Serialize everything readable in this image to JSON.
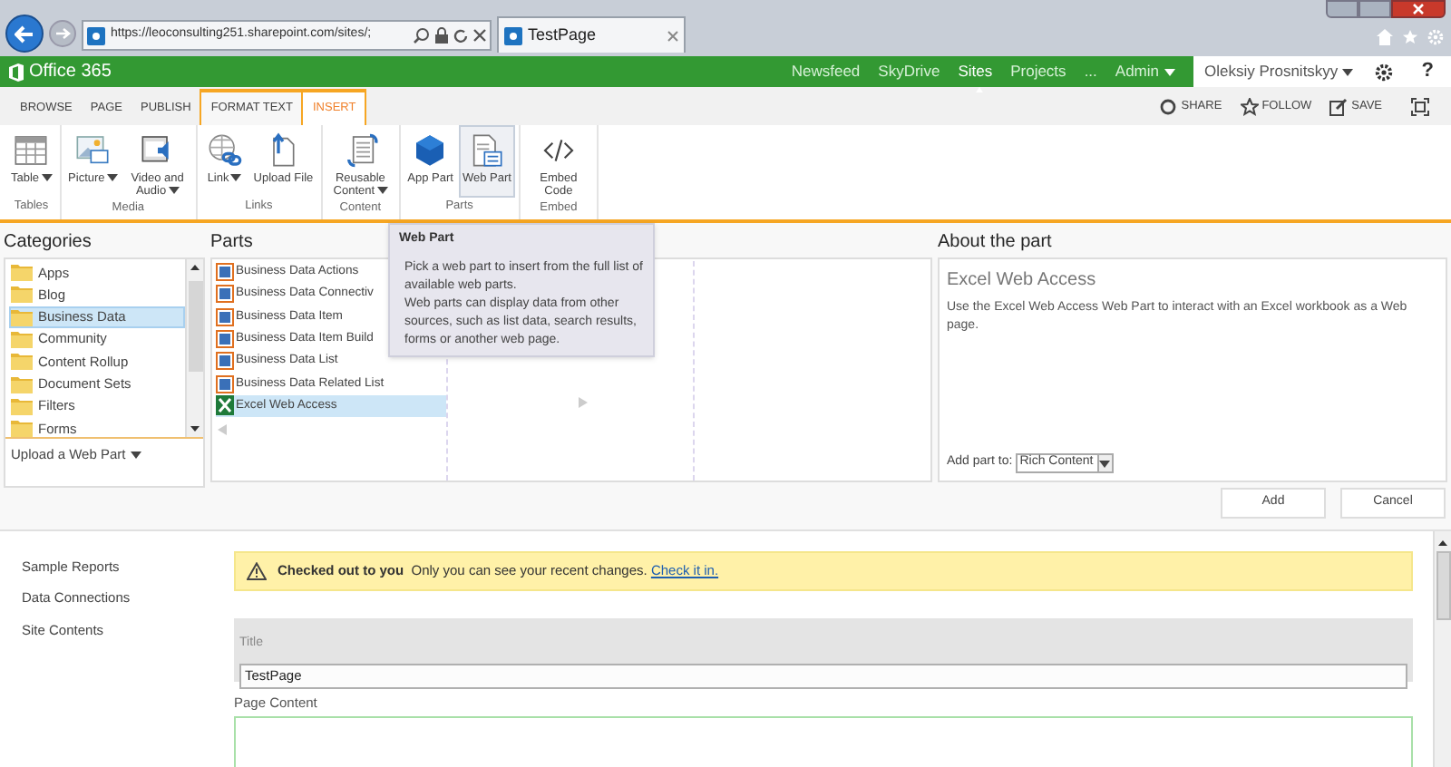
{
  "browser": {
    "address": "https://leoconsulting251.sharepoint.com/sites/;",
    "tab_title": "TestPage"
  },
  "suite_bar": {
    "brand": "Office 365",
    "nav": [
      {
        "label": "Newsfeed",
        "selected": false,
        "dropdown": false
      },
      {
        "label": "SkyDrive",
        "selected": false,
        "dropdown": false
      },
      {
        "label": "Sites",
        "selected": true,
        "dropdown": false
      },
      {
        "label": "Projects",
        "selected": false,
        "dropdown": false
      },
      {
        "label": "...",
        "selected": false,
        "dropdown": false
      },
      {
        "label": "Admin",
        "selected": false,
        "dropdown": true
      }
    ],
    "user": "Oleksiy Prosnitskyy",
    "help": "?"
  },
  "ribbon_tabs": [
    {
      "label": "BROWSE",
      "selected": false,
      "contextual": false
    },
    {
      "label": "PAGE",
      "selected": false,
      "contextual": false
    },
    {
      "label": "PUBLISH",
      "selected": false,
      "contextual": false
    },
    {
      "label": "FORMAT TEXT",
      "selected": false,
      "contextual": true
    },
    {
      "label": "INSERT",
      "selected": true,
      "contextual": true
    }
  ],
  "page_actions": [
    {
      "kind": "share",
      "label": "SHARE"
    },
    {
      "kind": "follow",
      "label": "FOLLOW"
    },
    {
      "kind": "save",
      "label": "SAVE"
    }
  ],
  "ribbon_groups": [
    {
      "label": "Tables",
      "commands": [
        {
          "kind": "table",
          "label": "Table",
          "dropdown": true,
          "selected": false
        }
      ]
    },
    {
      "label": "Media",
      "commands": [
        {
          "kind": "picture",
          "label": "Picture",
          "dropdown": true,
          "selected": false
        },
        {
          "kind": "video",
          "label": "Video and Audio",
          "dropdown": true,
          "selected": false
        }
      ]
    },
    {
      "label": "Links",
      "commands": [
        {
          "kind": "link",
          "label": "Link",
          "dropdown": true,
          "selected": false
        },
        {
          "kind": "upload",
          "label": "Upload File",
          "dropdown": false,
          "selected": false
        }
      ]
    },
    {
      "label": "Content",
      "commands": [
        {
          "kind": "reusable",
          "label": "Reusable Content",
          "dropdown": true,
          "selected": false
        }
      ]
    },
    {
      "label": "Parts",
      "commands": [
        {
          "kind": "app",
          "label": "App Part",
          "dropdown": false,
          "selected": false
        },
        {
          "kind": "webpart",
          "label": "Web Part",
          "dropdown": false,
          "selected": true
        }
      ]
    },
    {
      "label": "Embed",
      "commands": [
        {
          "kind": "embed",
          "label": "Embed Code",
          "dropdown": false,
          "selected": false
        }
      ]
    }
  ],
  "tooltip": {
    "title": "Web Part",
    "paragraphs": [
      "Pick a web part to insert from the full list of available web parts.",
      "Web parts can display data from other sources, such as list data, search results, forms or another web page."
    ]
  },
  "categories": {
    "heading": "Categories",
    "items": [
      {
        "label": "Apps",
        "selected": false
      },
      {
        "label": "Blog",
        "selected": false
      },
      {
        "label": "Business Data",
        "selected": true
      },
      {
        "label": "Community",
        "selected": false
      },
      {
        "label": "Content Rollup",
        "selected": false
      },
      {
        "label": "Document Sets",
        "selected": false
      },
      {
        "label": "Filters",
        "selected": false
      },
      {
        "label": "Forms",
        "selected": false
      }
    ],
    "upload": "Upload a Web Part"
  },
  "parts": {
    "heading": "Parts",
    "items": [
      {
        "kind": "bdc",
        "label": "Business Data Actions",
        "selected": false
      },
      {
        "kind": "bdc",
        "label": "Business Data Connectiv",
        "selected": false
      },
      {
        "kind": "bdc",
        "label": "Business Data Item",
        "selected": false
      },
      {
        "kind": "bdc",
        "label": "Business Data Item Build",
        "selected": false
      },
      {
        "kind": "bdc",
        "label": "Business Data List",
        "selected": false
      },
      {
        "kind": "bdc",
        "label": "Business Data Related List",
        "selected": false
      },
      {
        "kind": "excel",
        "label": "Excel Web Access",
        "selected": true
      }
    ]
  },
  "about": {
    "heading": "About the part",
    "title": "Excel Web Access",
    "description": "Use the Excel Web Access Web Part to interact with an Excel workbook as a Web page.",
    "add_to_label": "Add part to:",
    "add_to_value": "Rich Content"
  },
  "buttons": [
    "Add",
    "Cancel"
  ],
  "left_nav": [
    "Sample Reports",
    "Data Connections",
    "Site Contents"
  ],
  "status": {
    "text": "**Checked out to you**  Only you can see your recent changes.",
    "link": "Check it in."
  },
  "title_field": {
    "label": "Title",
    "value": "TestPage"
  },
  "page_content_label": "Page Content"
}
